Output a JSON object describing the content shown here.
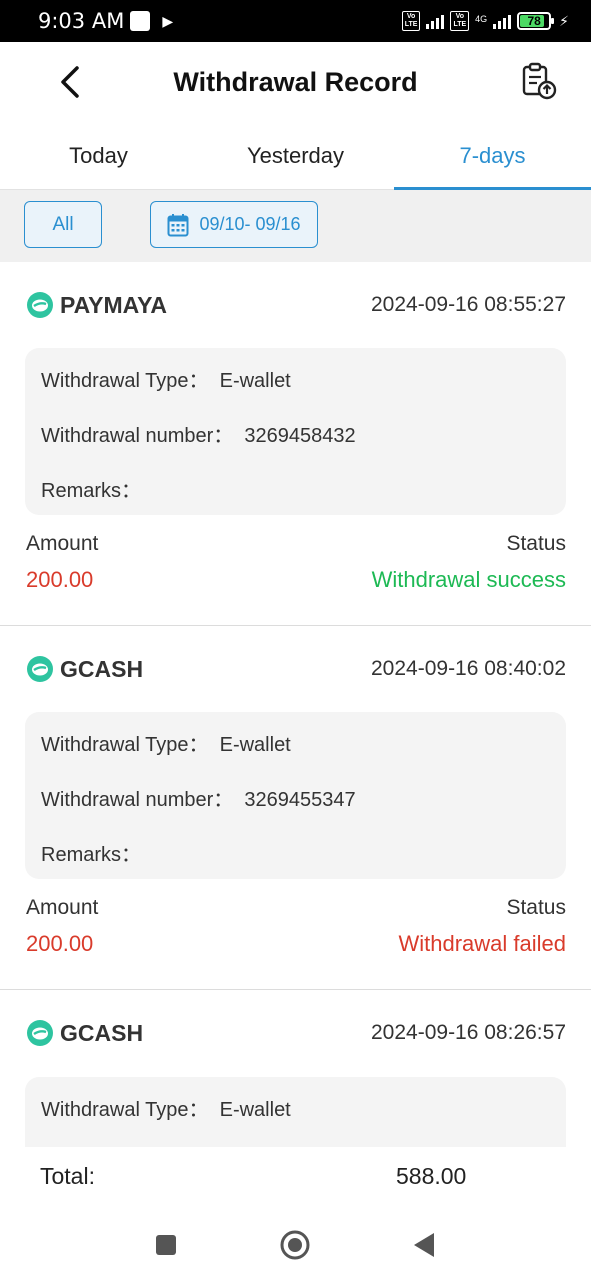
{
  "status_bar": {
    "time": "9:03 AM",
    "volte": "Vo LTE",
    "network": "4G",
    "battery": "78"
  },
  "header": {
    "title": "Withdrawal Record"
  },
  "tabs": [
    {
      "label": "Today",
      "active": false
    },
    {
      "label": "Yesterday",
      "active": false
    },
    {
      "label": "7-days",
      "active": true
    }
  ],
  "filter": {
    "all_label": "All",
    "date_range": "09/10- 09/16"
  },
  "records": [
    {
      "brand": "PAYMAYA",
      "time": "2024-09-16 08:55:27",
      "type_label": "Withdrawal Type：",
      "type_value": "E-wallet",
      "number_label": "Withdrawal number：",
      "number_value": "3269458432",
      "remarks_label": "Remarks：",
      "amount_label": "Amount",
      "amount": "200.00",
      "status_label": "Status",
      "status": "Withdrawal success"
    },
    {
      "brand": "GCASH",
      "time": "2024-09-16 08:40:02",
      "type_label": "Withdrawal Type：",
      "type_value": "E-wallet",
      "number_label": "Withdrawal number：",
      "number_value": "3269455347",
      "remarks_label": "Remarks：",
      "amount_label": "Amount",
      "amount": "200.00",
      "status_label": "Status",
      "status": "Withdrawal failed"
    },
    {
      "brand": "GCASH",
      "time": "2024-09-16 08:26:57",
      "type_label": "Withdrawal Type：",
      "type_value": "E-wallet"
    }
  ],
  "total": {
    "label": "Total:",
    "value": "588.00"
  },
  "colors": {
    "accent": "#2a8fd0",
    "success": "#1db954",
    "danger": "#d93b2b",
    "brand_icon": "#2ec4a0"
  }
}
